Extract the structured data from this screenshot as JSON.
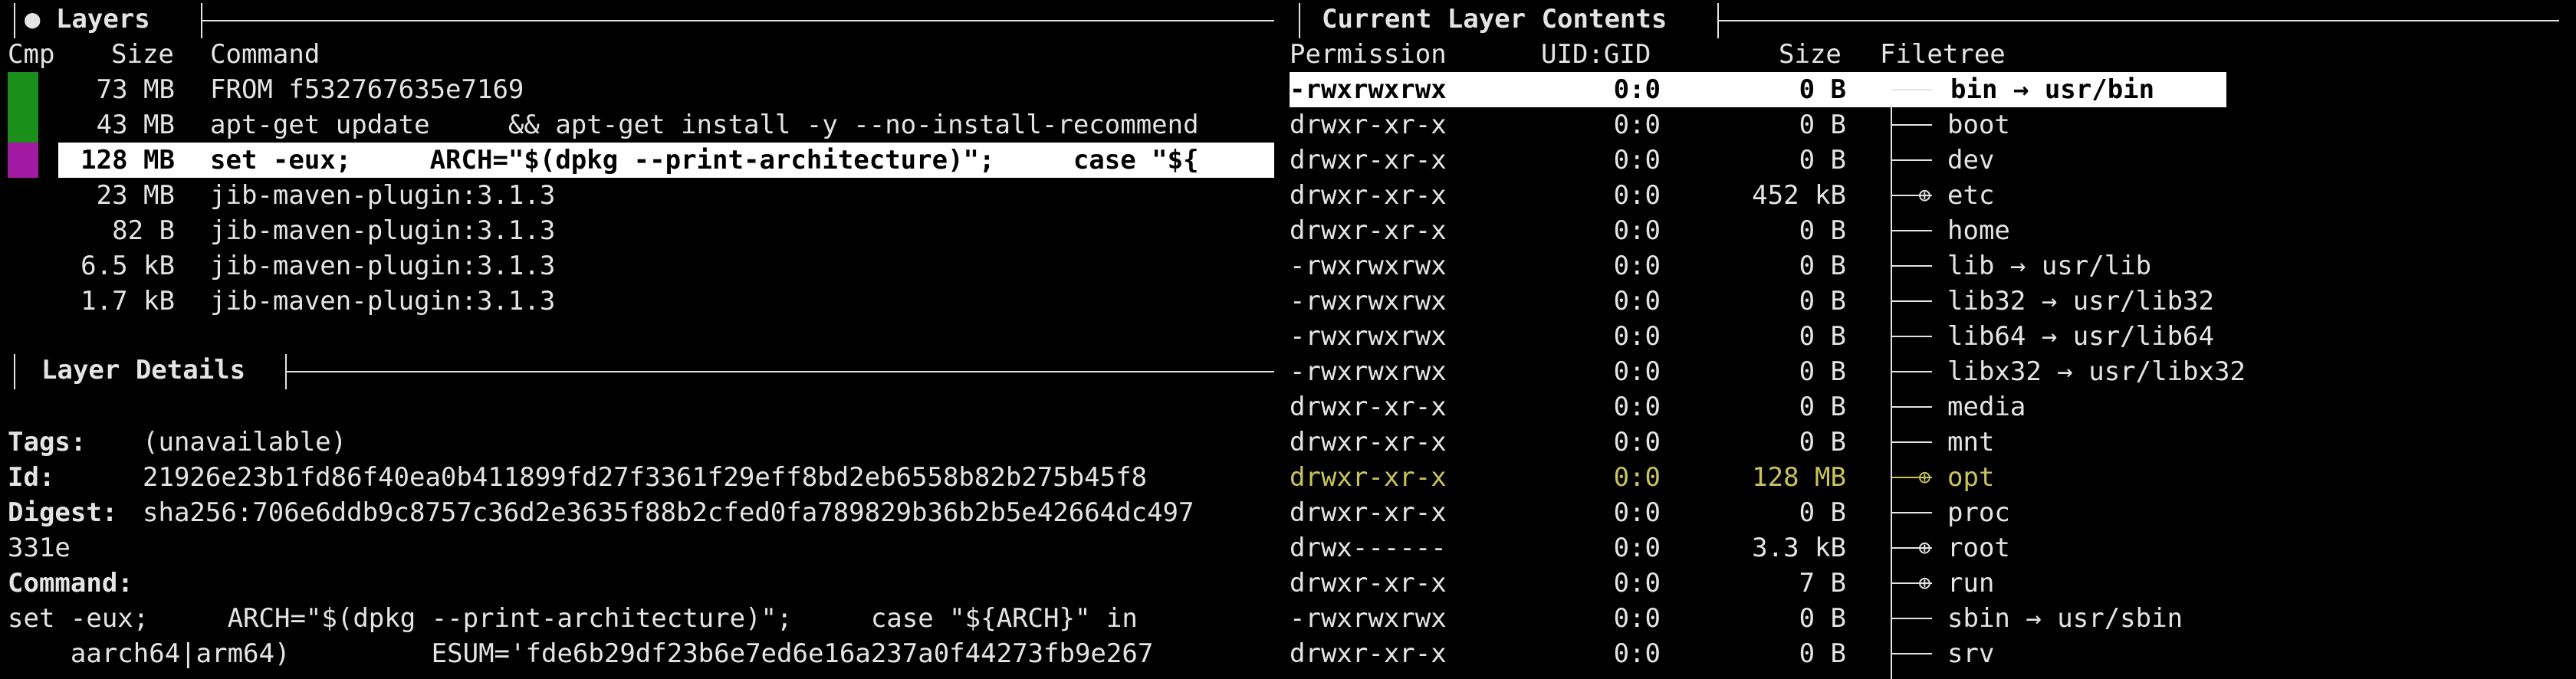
{
  "layers_panel": {
    "title": "● Layers",
    "headers": {
      "cmp": "Cmp",
      "size": "Size",
      "command": "Command"
    },
    "rows": [
      {
        "size": "73 MB",
        "command": "FROM f532767635e7169",
        "cmp_color": "#1a8f1a"
      },
      {
        "size": "43 MB",
        "command": "apt-get update     && apt-get install -y --no-install-recommend",
        "cmp_color": "#1a8f1a"
      },
      {
        "size": "128 MB",
        "command": "set -eux;     ARCH=\"$(dpkg --print-architecture)\";     case \"${",
        "cmp_color": "#a21aa2",
        "selected": true
      },
      {
        "size": "23 MB",
        "command": "jib-maven-plugin:3.1.3"
      },
      {
        "size": "82 B",
        "command": "jib-maven-plugin:3.1.3"
      },
      {
        "size": "6.5 kB",
        "command": "jib-maven-plugin:3.1.3"
      },
      {
        "size": "1.7 kB",
        "command": "jib-maven-plugin:3.1.3"
      }
    ]
  },
  "details_panel": {
    "title": "Layer Details",
    "tags_label": "Tags:",
    "tags_value": "(unavailable)",
    "id_label": "Id:",
    "id_value": "21926e23b1fd86f40ea0b411899fd27f3361f29eff8bd2eb6558b82b275b45f8",
    "digest_label": "Digest:",
    "digest_value": "sha256:706e6ddb9c8757c36d2e3635f88b2cfed0fa789829b36b2b5e42664dc497",
    "digest_cont": "331e",
    "command_label": "Command:",
    "command_line1": "set -eux;     ARCH=\"$(dpkg --print-architecture)\";     case \"${ARCH}\" in",
    "command_line2": "    aarch64|arm64)         ESUM='fde6b29df23b6e7ed6e16a237a0f44273fb9e267"
  },
  "contents_panel": {
    "title": "Current Layer Contents",
    "headers": {
      "permission": "Permission",
      "uidgid": "UID:GID",
      "size": "Size",
      "filetree": "Filetree"
    },
    "rows": [
      {
        "perm": "-rwxrwxrwx",
        "uid": "0:0",
        "size": "0 B",
        "icon": "├──",
        "name": "bin → usr/bin",
        "selected": true
      },
      {
        "perm": "drwxr-xr-x",
        "uid": "0:0",
        "size": "0 B",
        "icon": "├──",
        "name": "boot"
      },
      {
        "perm": "drwxr-xr-x",
        "uid": "0:0",
        "size": "0 B",
        "icon": "├──",
        "name": "dev"
      },
      {
        "perm": "drwxr-xr-x",
        "uid": "0:0",
        "size": "452 kB",
        "icon": "├─⊕",
        "name": "etc"
      },
      {
        "perm": "drwxr-xr-x",
        "uid": "0:0",
        "size": "0 B",
        "icon": "├──",
        "name": "home"
      },
      {
        "perm": "-rwxrwxrwx",
        "uid": "0:0",
        "size": "0 B",
        "icon": "├──",
        "name": "lib → usr/lib"
      },
      {
        "perm": "-rwxrwxrwx",
        "uid": "0:0",
        "size": "0 B",
        "icon": "├──",
        "name": "lib32 → usr/lib32"
      },
      {
        "perm": "-rwxrwxrwx",
        "uid": "0:0",
        "size": "0 B",
        "icon": "├──",
        "name": "lib64 → usr/lib64"
      },
      {
        "perm": "-rwxrwxrwx",
        "uid": "0:0",
        "size": "0 B",
        "icon": "├──",
        "name": "libx32 → usr/libx32"
      },
      {
        "perm": "drwxr-xr-x",
        "uid": "0:0",
        "size": "0 B",
        "icon": "├──",
        "name": "media"
      },
      {
        "perm": "drwxr-xr-x",
        "uid": "0:0",
        "size": "0 B",
        "icon": "├──",
        "name": "mnt"
      },
      {
        "perm": "drwxr-xr-x",
        "uid": "0:0",
        "size": "128 MB",
        "icon": "├─⊕",
        "name": "opt",
        "highlight": true
      },
      {
        "perm": "drwxr-xr-x",
        "uid": "0:0",
        "size": "0 B",
        "icon": "├──",
        "name": "proc"
      },
      {
        "perm": "drwx------",
        "uid": "0:0",
        "size": "3.3 kB",
        "icon": "├─⊕",
        "name": "root"
      },
      {
        "perm": "drwxr-xr-x",
        "uid": "0:0",
        "size": "7 B",
        "icon": "├─⊕",
        "name": "run"
      },
      {
        "perm": "-rwxrwxrwx",
        "uid": "0:0",
        "size": "0 B",
        "icon": "├──",
        "name": "sbin → usr/sbin"
      },
      {
        "perm": "drwxr-xr-x",
        "uid": "0:0",
        "size": "0 B",
        "icon": "├──",
        "name": "srv"
      }
    ]
  },
  "colors": {
    "added": "#1a8f1a",
    "modified": "#a21aa2",
    "highlight": "#c8c35a",
    "background": "#000000",
    "text": "#e4e4e4"
  }
}
